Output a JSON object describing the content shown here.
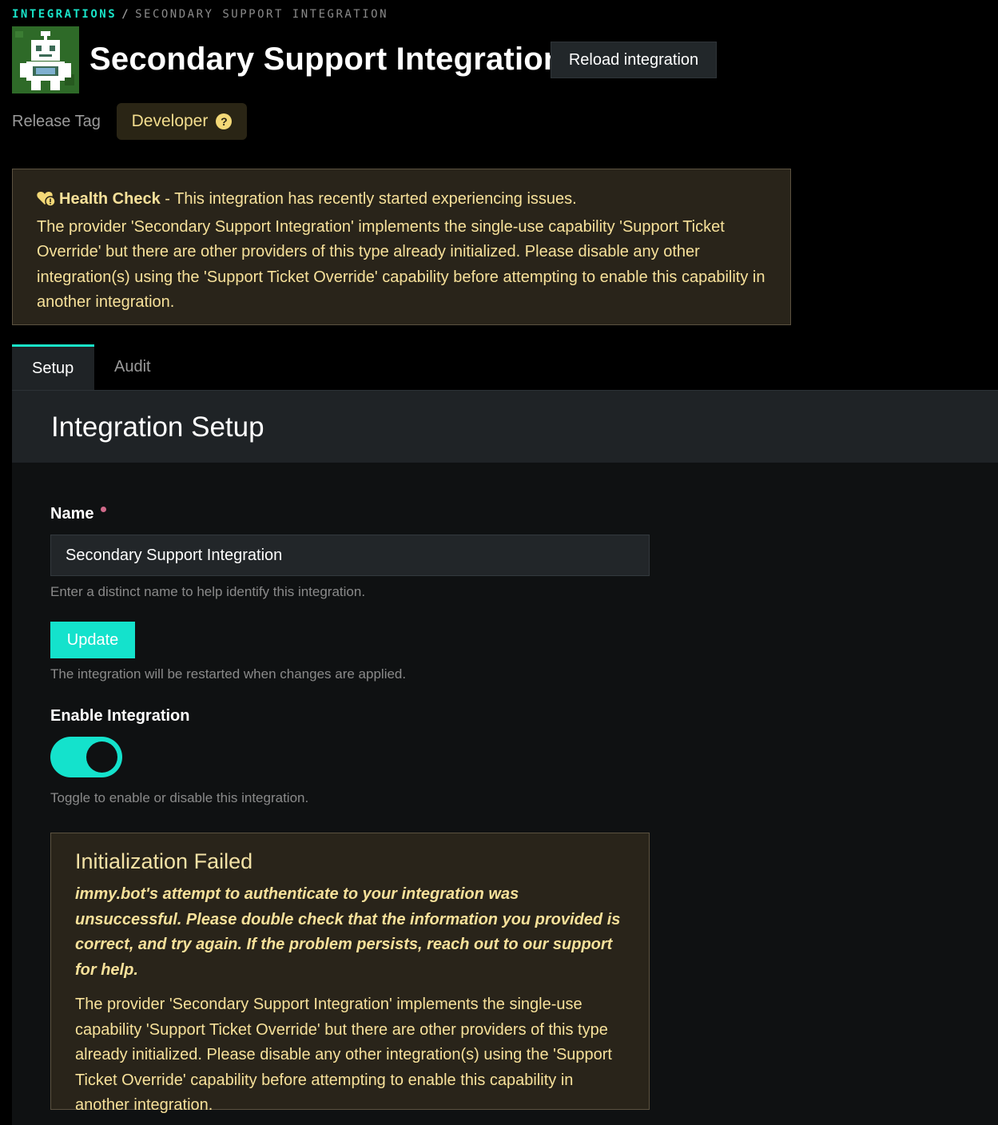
{
  "breadcrumb": {
    "parent": "INTEGRATIONS",
    "separator": "/",
    "current": "SECONDARY SUPPORT INTEGRATION"
  },
  "header": {
    "logo_icon": "robot-icon",
    "title": "Secondary Support Integration",
    "reload_label": "Reload integration"
  },
  "release": {
    "label": "Release Tag",
    "badge": "Developer",
    "help_glyph": "?"
  },
  "health_check": {
    "icon": "heart-warning-icon",
    "title": "Health Check",
    "summary": " - This integration has recently started experiencing issues.",
    "message": "The provider 'Secondary Support Integration' implements the single-use capability 'Support Ticket Override' but there are other providers of this type already initialized. Please disable any other integration(s) using the 'Support Ticket Override' capability before attempting to enable this capability in another integration."
  },
  "tabs": [
    {
      "label": "Setup",
      "active": true
    },
    {
      "label": "Audit",
      "active": false
    }
  ],
  "setup": {
    "heading": "Integration Setup",
    "name_label": "Name",
    "name_value": "Secondary Support Integration",
    "name_hint": "Enter a distinct name to help identify this integration.",
    "update_label": "Update",
    "update_hint": "The integration will be restarted when changes are applied.",
    "enable_label": "Enable Integration",
    "enabled": true,
    "enable_hint": "Toggle to enable or disable this integration."
  },
  "init_failed": {
    "title": "Initialization Failed",
    "emphasis": "immy.bot's attempt to authenticate to your integration was unsuccessful. Please double check that the information you provided is correct, and try again. If the problem persists, reach out to our support for help.",
    "message": "The provider 'Secondary Support Integration' implements the single-use capability 'Support Ticket Override' but there are other providers of this type already initialized. Please disable any other integration(s) using the 'Support Ticket Override' capability before attempting to enable this capability in another integration."
  },
  "colors": {
    "accent": "#14e2cc",
    "warning_bg": "#29241a",
    "warning_text": "#f7e19a",
    "required": "#d06a8a"
  }
}
